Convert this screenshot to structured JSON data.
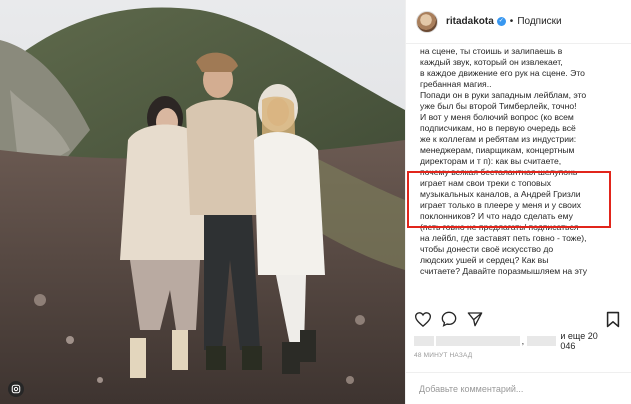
{
  "post": {
    "username": "ritadakota",
    "follow_label": "Подписки",
    "separator": "•",
    "verified_mark": "✓",
    "caption_lines": [
      "на сцене, ты стоишь и залипаешь в",
      "каждый звук, который он извлекает,",
      "в каждое движение его рук на сцене. Это",
      "гребанная магия..",
      "Попади он в руки западным лейблам, это",
      "уже был бы второй Тимберлейк, точно!",
      "И вот у меня болючий вопрос (ко всем",
      "подписчикам, но в первую очередь всё",
      "же к коллегам и ребятам из индустрии:",
      "менеджерам, пиарщикам, концертным",
      "директорам и т п): как вы считаете,",
      "почему всякая бесталантная шелупонь",
      "играет нам свои треки с топовых",
      "музыкальных каналов, а Андрей Гризли",
      "играет только в плеере у меня и у своих",
      "поклонников? И что надо сделать ему",
      "(петь говно не предлагать/ подписаться",
      "на лейбл, где заставят петь говно - тожe),",
      "чтобы донести своё искусство до",
      "людских ушей и сердец? Как вы",
      "считаете? Давайте поразмышляем на эту"
    ],
    "likes_count": "и еще 20 046",
    "likes_separator": ",",
    "time_ago": "48 МИНУТ НАЗАД",
    "comment_placeholder": "Добавьте комментарий..."
  },
  "icons": {
    "like": "heart-icon",
    "comment": "comment-icon",
    "share": "share-icon",
    "save": "bookmark-icon",
    "instagram": "instagram-icon"
  },
  "colors": {
    "verified": "#3897f0",
    "highlight": "#e1251b",
    "text": "#262626",
    "muted": "#999999"
  }
}
